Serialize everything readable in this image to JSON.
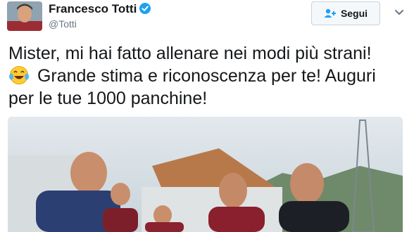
{
  "user": {
    "display_name": "Francesco Totti",
    "handle": "@Totti",
    "verified": true,
    "verified_icon": "verified-badge-icon"
  },
  "actions": {
    "follow_label": "Segui",
    "follow_icon": "add-user-icon",
    "more_icon": "chevron-down-icon"
  },
  "tweet": {
    "line1": "Mister, mi hai fatto allenare nei modi più strani!",
    "emoji": "face-with-tears-of-joy",
    "line2": " Grande stima e riconoscenza per te! Auguri",
    "line3": "per le tue 1000 panchine!"
  },
  "colors": {
    "accent": "#1da1f2",
    "text": "#14171a",
    "secondary": "#657786"
  }
}
